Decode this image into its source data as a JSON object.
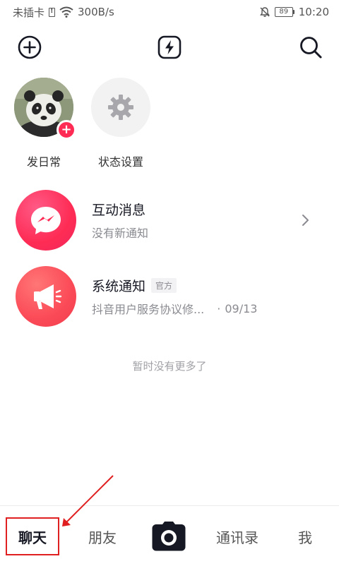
{
  "status_bar": {
    "carrier": "未插卡",
    "speed": "300B/s",
    "battery": "89",
    "time": "10:20"
  },
  "stories": [
    {
      "label": "发日常"
    },
    {
      "label": "状态设置"
    }
  ],
  "messages": [
    {
      "title": "互动消息",
      "subtitle": "没有新通知",
      "tag": "",
      "date": ""
    },
    {
      "title": "系统通知",
      "subtitle": "抖音用户服务协议修...",
      "tag": "官方",
      "date": "09/13"
    }
  ],
  "list_footer": "暂时没有更多了",
  "bottom_nav": {
    "chat": "聊天",
    "friends": "朋友",
    "contacts": "通讯录",
    "me": "我"
  },
  "colors": {
    "accent": "#fe2c55",
    "annotation": "#e02020"
  },
  "icons": [
    "sim-icon",
    "wifi-icon",
    "mute-icon",
    "battery-icon",
    "add-icon",
    "flash-icon",
    "search-icon",
    "plus-icon",
    "gear-icon",
    "interactive-message-icon",
    "megaphone-icon",
    "chevron-right-icon",
    "camera-icon"
  ]
}
